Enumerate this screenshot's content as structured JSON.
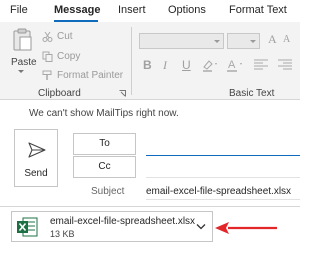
{
  "tabs": [
    {
      "label": "File"
    },
    {
      "label": "Message",
      "active": true
    },
    {
      "label": "Insert"
    },
    {
      "label": "Options"
    },
    {
      "label": "Format Text"
    }
  ],
  "ribbon": {
    "clipboard": {
      "paste_label": "Paste",
      "cut_label": "Cut",
      "copy_label": "Copy",
      "format_painter_label": "Format Painter",
      "group_label": "Clipboard"
    },
    "basic_text": {
      "group_label": "Basic Text",
      "bold_glyph": "B",
      "italic_glyph": "I",
      "underline_glyph": "U"
    }
  },
  "compose": {
    "mailtips": "We can't show MailTips right now.",
    "send_label": "Send",
    "to_label": "To",
    "cc_label": "Cc",
    "subject_label": "Subject",
    "subject_value": "email-excel-file-spreadsheet.xlsx"
  },
  "attachment": {
    "name": "email-excel-file-spreadsheet.xlsx",
    "size": "13 KB",
    "icon": "excel-file-icon"
  },
  "colors": {
    "accent": "#0f6cbd",
    "excel_green": "#1d7044",
    "annotation_red": "#e3262a"
  }
}
